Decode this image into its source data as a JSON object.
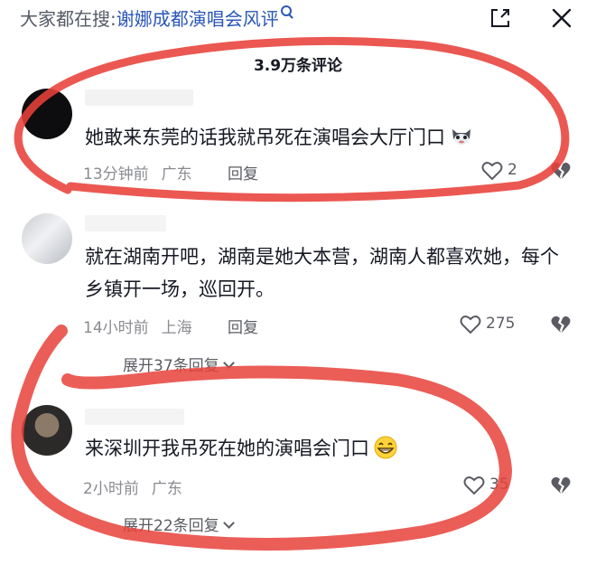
{
  "header": {
    "search_prefix": "大家都在搜:",
    "search_query": "谢娜成都演唱会风评",
    "comment_count": "3.9万条评论"
  },
  "colors": {
    "annotation": "#e8413a",
    "link": "#2b57b8",
    "meta": "#8a8b91"
  },
  "icons": [
    "search-icon",
    "expand-icon",
    "close-icon",
    "heart-icon",
    "broken-heart-icon",
    "chevron-down-icon",
    "cat-emoji",
    "grin-emoji"
  ],
  "comments": [
    {
      "text": "她敢来东莞的话我就吊死在演唱会大厅门口",
      "time": "13分钟前",
      "location": "广东",
      "reply_label": "回复",
      "likes": "2"
    },
    {
      "text": "就在湖南开吧，湖南是她大本营，湖南人都喜欢她，每个乡镇开一场，巡回开。",
      "time": "14小时前",
      "location": "上海",
      "reply_label": "回复",
      "likes": "275",
      "expand_label": "展开37条回复"
    },
    {
      "text": "来深圳开我吊死在她的演唱会门口",
      "time": "2小时前",
      "location": "广东",
      "likes": "35",
      "expand_label": "展开22条回复"
    }
  ]
}
